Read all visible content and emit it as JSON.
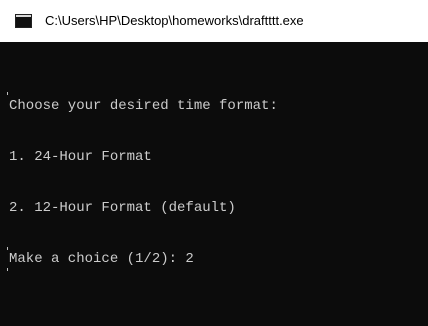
{
  "window": {
    "title": "C:\\Users\\HP\\Desktop\\homeworks\\draftttt.exe",
    "icon": "console-window-icon"
  },
  "console": {
    "lines": [
      "Choose your desired time format:",
      "1. 24-Hour Format",
      "2. 12-Hour Format (default)",
      "Make a choice (1/2): 2"
    ]
  },
  "colors": {
    "console_background": "#0c0c0c",
    "console_text": "#cccccc",
    "titlebar_background": "#ffffff",
    "title_text": "#000000"
  }
}
